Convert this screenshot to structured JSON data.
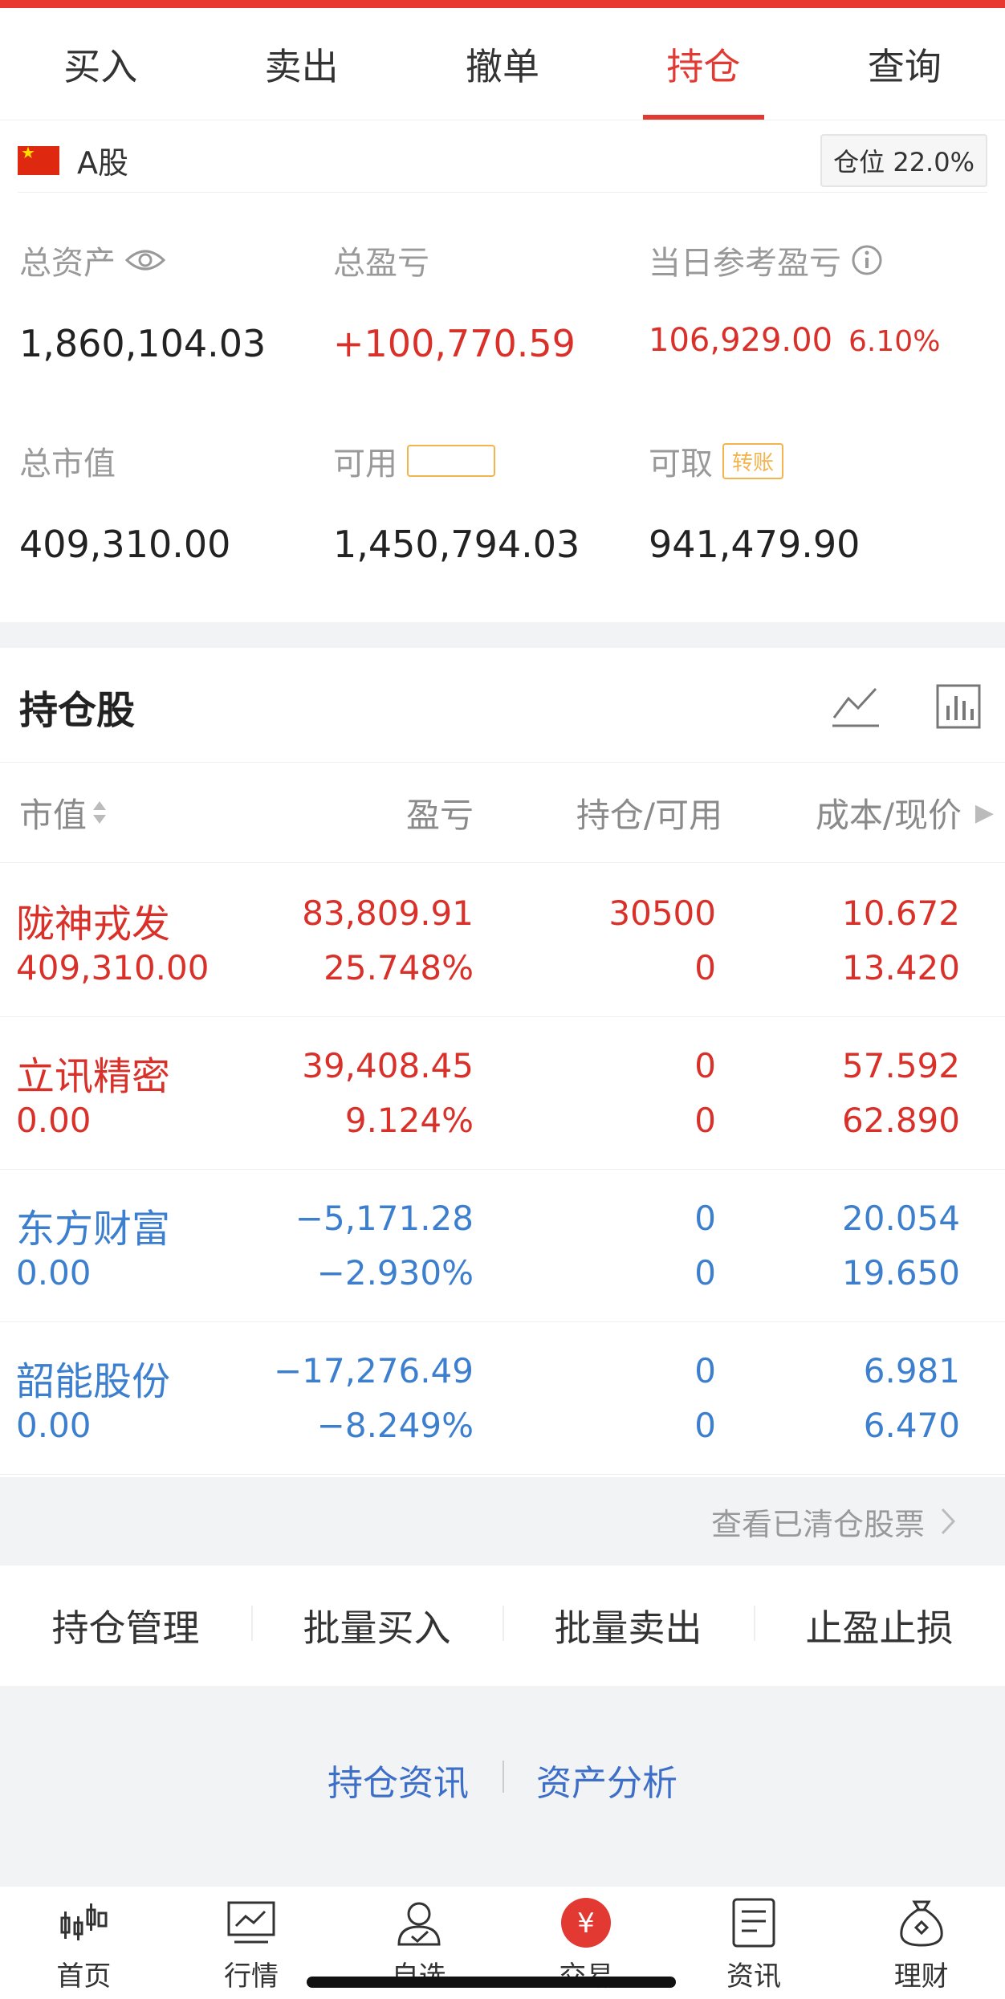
{
  "tabs": [
    {
      "label": "买入"
    },
    {
      "label": "卖出"
    },
    {
      "label": "撤单"
    },
    {
      "label": "持仓",
      "active": true
    },
    {
      "label": "查询"
    }
  ],
  "account": {
    "name": "A股",
    "position_label": "仓位 22.0%"
  },
  "stats": {
    "total_assets": {
      "label": "总资产",
      "value": "1,860,104.03"
    },
    "total_pl": {
      "label": "总盈亏",
      "value": "+100,770.59"
    },
    "today_pl": {
      "label": "当日参考盈亏",
      "value": "106,929.00",
      "pct": "6.10%"
    },
    "market_value": {
      "label": "总市值",
      "value": "409,310.00"
    },
    "available": {
      "label": "可用",
      "tag": "",
      "value": "1,450,794.03"
    },
    "withdrawable": {
      "label": "可取",
      "tag": "转账",
      "value": "941,479.90"
    }
  },
  "holdings": {
    "title": "持仓股",
    "columns": [
      "市值",
      "盈亏",
      "持仓/可用",
      "成本/现价"
    ],
    "rows": [
      {
        "name": "陇神戎发",
        "market_value": "409,310.00",
        "pl": "83,809.91",
        "pl_pct": "25.748%",
        "hold": "30500",
        "avail": "0",
        "cost": "10.672",
        "price": "13.420",
        "color": "#d9312a"
      },
      {
        "name": "立讯精密",
        "market_value": "0.00",
        "pl": "39,408.45",
        "pl_pct": "9.124%",
        "hold": "0",
        "avail": "0",
        "cost": "57.592",
        "price": "62.890",
        "color": "#d9312a"
      },
      {
        "name": "东方财富",
        "market_value": "0.00",
        "pl": "−5,171.28",
        "pl_pct": "−2.930%",
        "hold": "0",
        "avail": "0",
        "cost": "20.054",
        "price": "19.650",
        "color": "#3d7fcf"
      },
      {
        "name": "韶能股份",
        "market_value": "0.00",
        "pl": "−17,276.49",
        "pl_pct": "−8.249%",
        "hold": "0",
        "avail": "0",
        "cost": "6.981",
        "price": "6.470",
        "color": "#3d7fcf"
      }
    ]
  },
  "cleared_link": "查看已清仓股票",
  "actions": [
    "持仓管理",
    "批量买入",
    "批量卖出",
    "止盈止损"
  ],
  "info_links": [
    "持仓资讯",
    "资产分析"
  ],
  "bottom_nav": [
    {
      "label": "首页",
      "icon": "candlestick-icon"
    },
    {
      "label": "行情",
      "icon": "chart-line-icon"
    },
    {
      "label": "自选",
      "icon": "person-icon"
    },
    {
      "label": "交易",
      "icon": "yuan-icon",
      "active": true
    },
    {
      "label": "资讯",
      "icon": "document-icon"
    },
    {
      "label": "理财",
      "icon": "money-bag-icon"
    }
  ],
  "colors": {
    "accent": "#e23a33",
    "red": "#d9312a",
    "blue": "#3d7fcf"
  }
}
